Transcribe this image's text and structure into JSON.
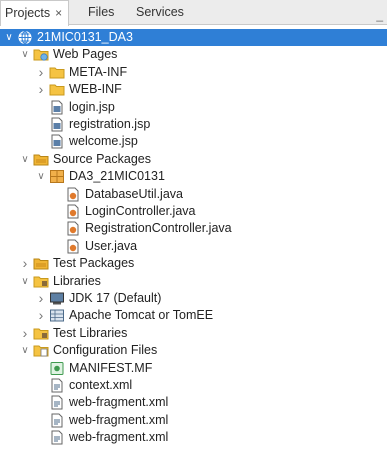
{
  "tabs": [
    {
      "label": "Projects",
      "close": "×"
    },
    {
      "label": "Files"
    },
    {
      "label": "Services"
    }
  ],
  "minimize_glyph": "_",
  "tree": [
    {
      "label": "21MIC0131_DA3",
      "icon": "globe-icon",
      "depth": 0,
      "chevron": "v",
      "selected": true
    },
    {
      "label": "Web Pages",
      "icon": "web-folder-icon",
      "depth": 1,
      "chevron": "v"
    },
    {
      "label": "META-INF",
      "icon": "folder-icon",
      "depth": 2,
      "chevron": ">"
    },
    {
      "label": "WEB-INF",
      "icon": "folder-icon",
      "depth": 2,
      "chevron": ">"
    },
    {
      "label": "login.jsp",
      "icon": "jsp-file-icon",
      "depth": 2,
      "chevron": ""
    },
    {
      "label": "registration.jsp",
      "icon": "jsp-file-icon",
      "depth": 2,
      "chevron": ""
    },
    {
      "label": "welcome.jsp",
      "icon": "jsp-file-icon",
      "depth": 2,
      "chevron": ""
    },
    {
      "label": "Source Packages",
      "icon": "source-folder-icon",
      "depth": 1,
      "chevron": "v"
    },
    {
      "label": "DA3_21MIC0131",
      "icon": "package-icon",
      "depth": 2,
      "chevron": "v"
    },
    {
      "label": "DatabaseUtil.java",
      "icon": "java-file-icon",
      "depth": 3,
      "chevron": ""
    },
    {
      "label": "LoginController.java",
      "icon": "java-file-icon",
      "depth": 3,
      "chevron": ""
    },
    {
      "label": "RegistrationController.java",
      "icon": "java-file-icon",
      "depth": 3,
      "chevron": ""
    },
    {
      "label": "User.java",
      "icon": "java-file-icon",
      "depth": 3,
      "chevron": ""
    },
    {
      "label": "Test Packages",
      "icon": "source-folder-icon",
      "depth": 1,
      "chevron": ">"
    },
    {
      "label": "Libraries",
      "icon": "library-folder-icon",
      "depth": 1,
      "chevron": "v"
    },
    {
      "label": "JDK 17 (Default)",
      "icon": "jdk-icon",
      "depth": 2,
      "chevron": ">"
    },
    {
      "label": "Apache Tomcat or TomEE",
      "icon": "server-library-icon",
      "depth": 2,
      "chevron": ">"
    },
    {
      "label": "Test Libraries",
      "icon": "library-folder-icon",
      "depth": 1,
      "chevron": ">"
    },
    {
      "label": "Configuration Files",
      "icon": "config-folder-icon",
      "depth": 1,
      "chevron": "v"
    },
    {
      "label": "MANIFEST.MF",
      "icon": "manifest-icon",
      "depth": 2,
      "chevron": ""
    },
    {
      "label": "context.xml",
      "icon": "xml-file-icon",
      "depth": 2,
      "chevron": ""
    },
    {
      "label": "web-fragment.xml",
      "icon": "xml-file-icon",
      "depth": 2,
      "chevron": ""
    },
    {
      "label": "web-fragment.xml",
      "icon": "xml-file-icon",
      "depth": 2,
      "chevron": ""
    },
    {
      "label": "web-fragment.xml",
      "icon": "xml-file-icon",
      "depth": 2,
      "chevron": ""
    }
  ]
}
